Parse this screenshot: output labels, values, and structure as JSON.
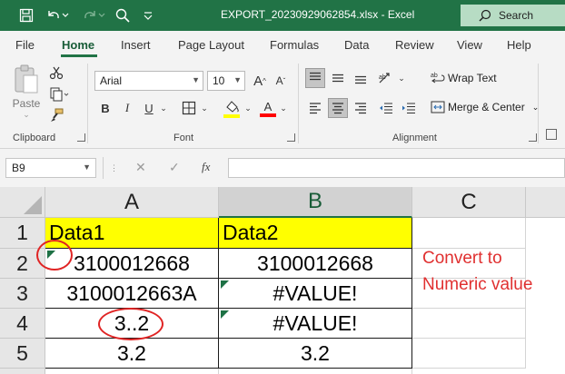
{
  "window": {
    "title": "EXPORT_20230929062854.xlsx  -  Excel",
    "search_label": "Search"
  },
  "quick_access": [
    "save-icon",
    "undo-icon",
    "redo-icon",
    "search-icon"
  ],
  "ribbon_tabs": [
    "File",
    "Home",
    "Insert",
    "Page Layout",
    "Formulas",
    "Data",
    "Review",
    "View",
    "Help"
  ],
  "active_tab": "Home",
  "clipboard": {
    "paste_label": "Paste",
    "group_label": "Clipboard"
  },
  "font": {
    "name": "Arial",
    "size": "10",
    "bold": "B",
    "italic": "I",
    "underline": "U",
    "group_label": "Font",
    "fill_color": "#ffff00",
    "font_color": "#ff0000"
  },
  "alignment": {
    "wrap_text": "Wrap Text",
    "merge_center": "Merge & Center",
    "group_label": "Alignment"
  },
  "formula_bar": {
    "name_box": "B9",
    "fx": "fx",
    "formula": ""
  },
  "grid": {
    "columns": [
      "A",
      "B",
      "C"
    ],
    "selected_column": "B",
    "rows": [
      {
        "num": "1",
        "a": "Data1",
        "b": "Data2"
      },
      {
        "num": "2",
        "a": "3100012668",
        "b": "3100012668"
      },
      {
        "num": "3",
        "a": "3100012663A",
        "b": "#VALUE!"
      },
      {
        "num": "4",
        "a": "3..2",
        "b": "#VALUE!"
      },
      {
        "num": "5",
        "a": "3.2",
        "b": "3.2"
      }
    ],
    "header_fill": "#ffff00",
    "error_indicator_color": "#1e7145"
  },
  "annotation": {
    "line1": "Convert to",
    "line2": "Numeric value",
    "color": "#e03030"
  }
}
